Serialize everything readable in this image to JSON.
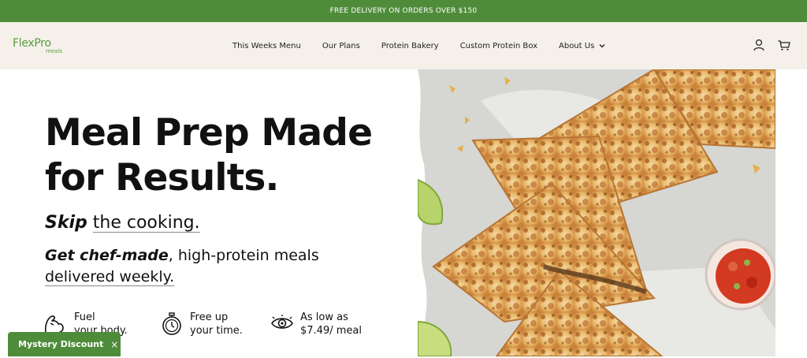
{
  "promo": {
    "text": "FREE DELIVERY ON ORDERS OVER $150"
  },
  "logo": {
    "top": "FlexPro",
    "bottom": "meals"
  },
  "nav": {
    "items": [
      "This Weeks Menu",
      "Our Plans",
      "Protein Bakery",
      "Custom Protein Box",
      "About Us"
    ]
  },
  "hero": {
    "title": "Meal Prep Made for Results.",
    "tagline1_bold": "Skip",
    "tagline1_rest": "the cooking.",
    "tagline2_bold": "Get chef-made",
    "tagline2_rest": ", high-protein meals",
    "tagline2_line2": "delivered weekly."
  },
  "features": [
    {
      "icon": "flexed-arm-icon",
      "line1": "Fuel",
      "line2": "your body."
    },
    {
      "icon": "stopwatch-icon",
      "line1": "Free up",
      "line2": "your time."
    },
    {
      "icon": "eye-icon",
      "line1": "As low as",
      "line2": "$7.49/ meal"
    }
  ],
  "mystery": {
    "label": "Mystery Discount",
    "close": "×"
  },
  "colors": {
    "brand_green": "#4f8c3a",
    "header_bg": "#f5f1ea"
  }
}
